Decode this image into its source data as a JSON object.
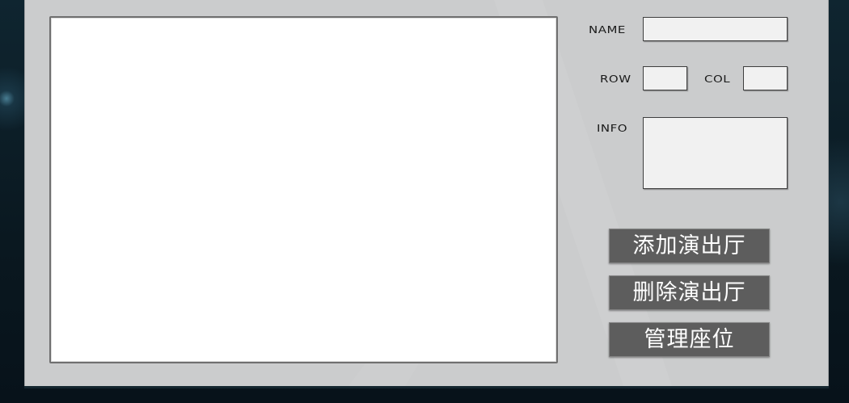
{
  "form": {
    "name_label": "NAME",
    "name_value": "",
    "row_label": "ROW",
    "row_value": "",
    "col_label": "COL",
    "col_value": "",
    "info_label": "INFO",
    "info_value": ""
  },
  "actions": {
    "add_label": "添加演出厅",
    "delete_label": "删除演出厅",
    "manage_label": "管理座位"
  },
  "colors": {
    "background": "#0b1a22",
    "panel": "#cbcccd",
    "button": "#5d5d5d",
    "field": "#f1f1f1"
  }
}
